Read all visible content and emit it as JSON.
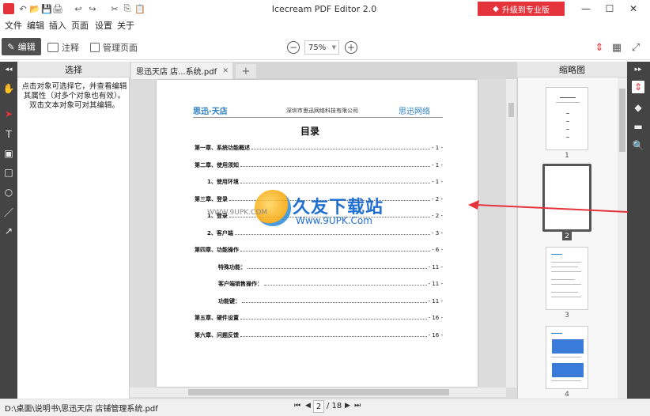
{
  "titlebar": {
    "title": "Icecream PDF Editor 2.0",
    "upgrade_label": "升级到专业版",
    "minimize": "—",
    "maximize": "☐",
    "close": "✕"
  },
  "quick_access": [
    "↶",
    "📂",
    "💾",
    "🖨",
    "↩",
    "↪",
    "✂",
    "⎘",
    "📋"
  ],
  "menu": {
    "items": [
      "文件",
      "编辑",
      "插入",
      "页面",
      "设置",
      "关于"
    ]
  },
  "toolbar": {
    "edit_label": "编辑",
    "annotate_label": "注释",
    "manage_pages_label": "管理页面",
    "zoom_value": "75%"
  },
  "left_panel": {
    "title": "选择",
    "help_text": "点击对象可选择它，并查看编辑其属性（对多个对象也有效）。双击文本对象可对其编辑。"
  },
  "doc_tab": {
    "name": "思迅天店 店...系统.pdf",
    "close": "✕",
    "add": "+"
  },
  "page": {
    "logo_left": "思迅·天店",
    "company": "深圳市思迅网络科技有限公司",
    "logo_right": "思迅网络",
    "toc_title": "目录",
    "toc": [
      {
        "label": "第一章、系统功能概述",
        "page": "- 1 -",
        "level": 0
      },
      {
        "label": "第二章、使用须知",
        "page": "- 1 -",
        "level": 0
      },
      {
        "label": "1、使用环境",
        "page": "- 1 -",
        "level": 1
      },
      {
        "label": "第三章、登录",
        "page": "- 2 -",
        "level": 0
      },
      {
        "label": "1、登录",
        "page": "- 2 -",
        "level": 1
      },
      {
        "label": "2、客户端",
        "page": "- 3 -",
        "level": 1
      },
      {
        "label": "第四章、功能操作",
        "page": "- 6 -",
        "level": 0
      },
      {
        "label": "特殊功能：",
        "page": "- 11 -",
        "level": 2
      },
      {
        "label": "客户端销售操作：",
        "page": "- 11 -",
        "level": 2
      },
      {
        "label": "功能键：",
        "page": "- 11 -",
        "level": 2
      },
      {
        "label": "第五章、硬件设置",
        "page": "- 16 -",
        "level": 0
      },
      {
        "label": "第六章、问题反馈",
        "page": "- 16 -",
        "level": 0
      }
    ]
  },
  "watermark": {
    "title": "久友下载站",
    "url_left": "WWW.9UPK.COM",
    "url": "Www.9UPK.Com"
  },
  "thumbnails": {
    "title": "缩略图",
    "pages": [
      "1",
      "2",
      "3",
      "4"
    ]
  },
  "left_tools": [
    "✋",
    "➤",
    "T",
    "▣",
    "□",
    "○",
    "／",
    "↗"
  ],
  "right_tools": [
    "◆",
    "▐",
    "▬",
    "🔍"
  ],
  "status": {
    "file_path": "D:\\桌面\\说明书\\思迅天店 店铺管理系统.pdf",
    "current_page": "2",
    "total_pages": "/ 18"
  },
  "colors": {
    "accent": "#e5333b",
    "dark_bar": "#444444"
  }
}
